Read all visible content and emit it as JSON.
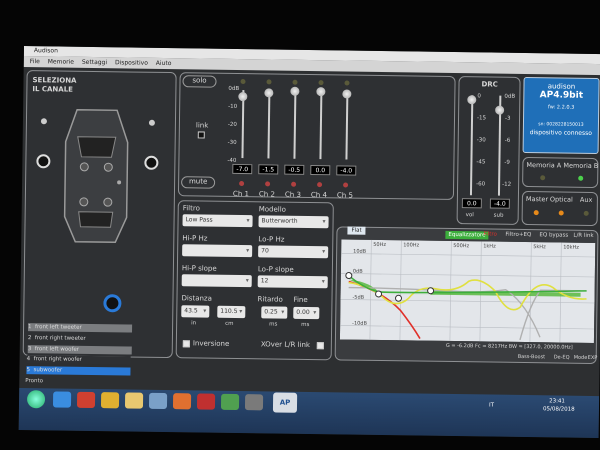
{
  "window": {
    "title": "Audison",
    "status": "Pronto"
  },
  "menu": [
    "File",
    "Memorie",
    "Settaggi",
    "Dispositivo",
    "Aiuto"
  ],
  "left": {
    "title_line1": "SELEZIONA",
    "title_line2": "IL CANALE",
    "channels": [
      {
        "num": "1",
        "name": "front left tweeter"
      },
      {
        "num": "2",
        "name": "front right tweeter"
      },
      {
        "num": "3",
        "name": "front left woofer"
      },
      {
        "num": "4",
        "name": "front right woofer"
      },
      {
        "num": "5",
        "name": "subwoofer"
      }
    ]
  },
  "faders": {
    "solo": "solo",
    "mute": "mute",
    "link": "link",
    "scale": [
      "0dB",
      "-10",
      "-20",
      "-30",
      "-40"
    ],
    "channels": [
      {
        "label": "Ch 1",
        "value": "-7.0"
      },
      {
        "label": "Ch 2",
        "value": "-1.5"
      },
      {
        "label": "Ch 3",
        "value": "-0.5"
      },
      {
        "label": "Ch 4",
        "value": "0.0"
      },
      {
        "label": "Ch 5",
        "value": "-4.0"
      }
    ]
  },
  "drc": {
    "title": "DRC",
    "vol_scale": [
      "0",
      "-15",
      "-30",
      "-45",
      "-60"
    ],
    "sub_scale": [
      "0dB",
      "-3",
      "-6",
      "-9",
      "-12"
    ],
    "vol_value": "0.0",
    "sub_value": "-4.0",
    "vol_label": "vol",
    "sub_label": "sub"
  },
  "device": {
    "brand": "audison",
    "model": "AP4.9bit",
    "fw": "fw: 2.2.0.3",
    "serial": "sn: 0028228150013",
    "status": "dispositivo connesso"
  },
  "memory": {
    "a": "Memoria A",
    "b": "Memoria B"
  },
  "inputs": {
    "master": "Master",
    "optical": "Optical",
    "aux": "Aux"
  },
  "filter": {
    "filtro_label": "Filtro",
    "filtro_value": "Low Pass",
    "modello_label": "Modello",
    "modello_value": "Butterworth",
    "hip_hz_label": "Hi-P Hz",
    "hip_hz_value": "",
    "lop_hz_label": "Lo-P Hz",
    "lop_hz_value": "70",
    "hip_slope_label": "Hi-P slope",
    "hip_slope_value": "",
    "lop_slope_label": "Lo-P slope",
    "lop_slope_value": "12",
    "distanza_label": "Distanza",
    "distanza_in": "43.5",
    "distanza_cm": "110.5",
    "in_label": "in",
    "cm_label": "cm",
    "ritardo_label": "Ritardo",
    "ritardo_value": "0.25",
    "fine_label": "Fine",
    "fine_value": "0.00",
    "ms_label": "ms",
    "inversione_label": "Inversione",
    "xover_label": "XOver L/R link"
  },
  "graph": {
    "flat_tab": "Flat",
    "equalizzatore": "Equalizzatore",
    "filtro": "Filtro",
    "filtro_eq": "Filtro+EQ",
    "eq_bypass": "EQ bypass",
    "lr_link": "L/R link",
    "freq_labels": [
      "50Hz",
      "100Hz",
      "500Hz",
      "1kHz",
      "5kHz",
      "10kHz"
    ],
    "db_labels": [
      "10dB",
      "0dB",
      "-5dB",
      "-10dB"
    ],
    "readout": "G = -6.2dB     Fc = 8217Hz     BW = [327.0, 20000.0Hz]",
    "bass_boost": "Bass-Boost",
    "de_eq": "De-EQ",
    "mode": "Mode",
    "exp": "EXP"
  },
  "taskbar": {
    "app_label": "AP",
    "lang": "IT",
    "time": "23:41",
    "date": "05/08/2018"
  },
  "colors": {
    "device_bg": "#1f6fb8",
    "eq_green": "#3cae3c",
    "curve_yellow": "#e0e040",
    "curve_red": "#e0302a",
    "curve_green": "#59b840",
    "curve_grey": "#b0b0b0"
  }
}
